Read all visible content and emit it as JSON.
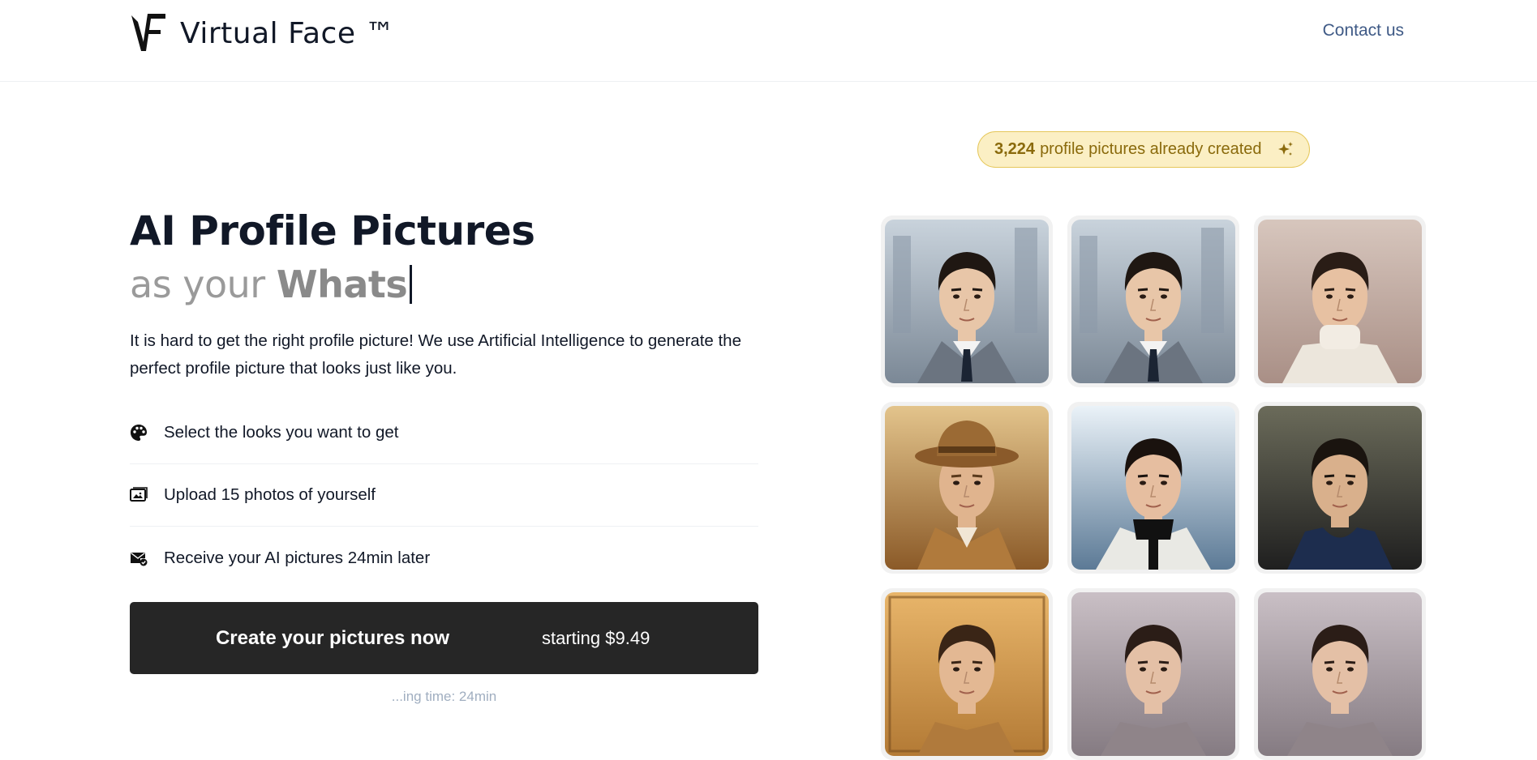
{
  "header": {
    "logo_mark": "VF",
    "brand": "Virtual Face ™",
    "contact_label": "Contact us"
  },
  "hero": {
    "title": "AI Profile Pictures",
    "subtitle_prefix": "as your ",
    "subtitle_typed": "Whats",
    "description": "It is hard to get the right profile picture! We use Artificial Intelligence to generate the perfect profile picture that looks just like you.",
    "steps": [
      {
        "icon": "palette-icon",
        "label": "Select the looks you want to get"
      },
      {
        "icon": "images-icon",
        "label": "Upload 15 photos of yourself"
      },
      {
        "icon": "envelope-check-icon",
        "label": "Receive your AI pictures 24min later"
      }
    ],
    "cta": {
      "label": "Create your pictures now",
      "price": "starting $9.49"
    },
    "cta_note": "...ing time: 24min"
  },
  "badge": {
    "count": "3,224",
    "text": "profile pictures already created",
    "icon": "sparkles-icon"
  },
  "gallery": [
    {
      "name": "suit-city-grey",
      "style": "suit"
    },
    {
      "name": "suit-city-navy",
      "style": "suit"
    },
    {
      "name": "turtleneck",
      "style": "turtleneck"
    },
    {
      "name": "fedora-desert",
      "style": "fedora"
    },
    {
      "name": "racing-driver",
      "style": "racing"
    },
    {
      "name": "tank-top",
      "style": "tank"
    },
    {
      "name": "portrait-gold",
      "style": "gold"
    },
    {
      "name": "portrait-grey-1",
      "style": "grey"
    },
    {
      "name": "portrait-grey-2",
      "style": "grey"
    }
  ],
  "colors": {
    "accent": "#262626",
    "link": "#3f5a86",
    "badge_bg": "#fbefc4",
    "badge_border": "#e5c75a",
    "badge_text": "#8a6a0c",
    "subtitle_grey": "#9a9a9a"
  }
}
